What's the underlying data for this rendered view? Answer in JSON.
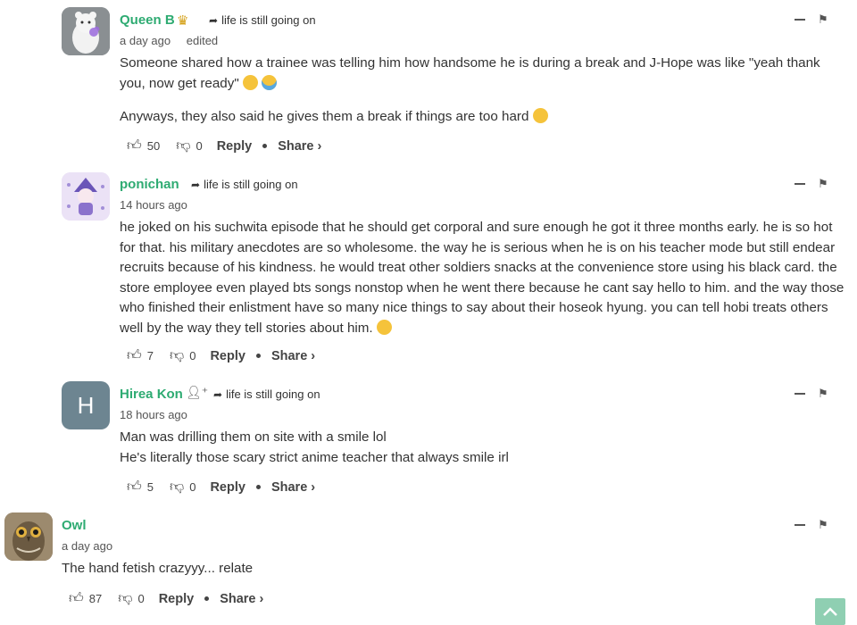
{
  "comments": [
    {
      "author": "Queen B",
      "reply_to": "life is still going on",
      "time": "a day ago",
      "edited": "edited",
      "paragraphs": [
        "Someone shared how a trainee was telling him how handsome he is during a break and J-Hope was like \"yeah thank you, now get ready\"",
        "Anyways, they also said he gives them a break if things are too hard"
      ],
      "likes": "50",
      "dislikes": "0",
      "reply_label": "Reply",
      "share_label": "Share ›"
    },
    {
      "author": "ponichan",
      "reply_to": "life is still going on",
      "time": "14 hours ago",
      "paragraphs": [
        "he joked on his suchwita episode that he should get corporal and sure enough he got it three months early. he is so hot for that. his military anecdotes are so wholesome. the way he is serious when he is on his teacher mode but still endear recruits because of his kindness. he would treat other soldiers snacks at the convenience store using his black card. the store employee even played bts songs nonstop when he went there because he cant say hello to him. and the way those who finished their enlistment have so many nice things to say about their hoseok hyung. you can tell hobi treats others well by the way they tell stories about him."
      ],
      "likes": "7",
      "dislikes": "0",
      "reply_label": "Reply",
      "share_label": "Share ›"
    },
    {
      "author": "Hirea Kon",
      "avatar_letter": "H",
      "reply_to": "life is still going on",
      "time": "18 hours ago",
      "paragraphs": [
        "Man was drilling them on site with a smile lol",
        "He's literally those scary strict anime teacher that always smile irl"
      ],
      "likes": "5",
      "dislikes": "0",
      "reply_label": "Reply",
      "share_label": "Share ›"
    },
    {
      "author": "Owl",
      "time": "a day ago",
      "paragraphs": [
        "The hand fetish crazyyy... relate"
      ],
      "likes": "87",
      "dislikes": "0",
      "reply_label": "Reply",
      "share_label": "Share ›"
    }
  ],
  "colors": {
    "author": "#2eab72",
    "avatar_letter_bg": "#6d8591",
    "scroll_top_bg": "#8fcfb2"
  }
}
